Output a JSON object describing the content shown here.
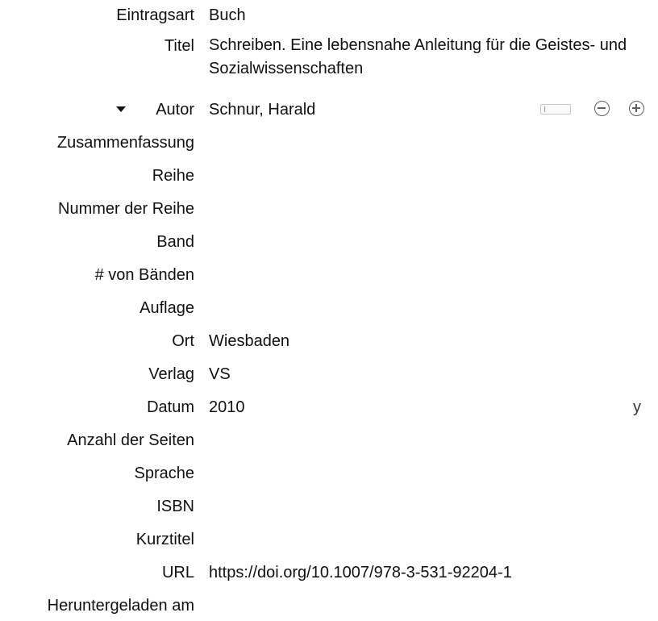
{
  "fields": {
    "item_type": {
      "label": "Eintragsart",
      "value": "Buch"
    },
    "title": {
      "label": "Titel",
      "value": "Schreiben. Eine lebensnahe Anleitung für die Geistes- und Sozialwissenschaften"
    },
    "author": {
      "label": "Autor",
      "value": "Schnur, Harald"
    },
    "abstract": {
      "label": "Zusammenfassung",
      "value": ""
    },
    "series": {
      "label": "Reihe",
      "value": ""
    },
    "series_number": {
      "label": "Nummer der Reihe",
      "value": ""
    },
    "volume": {
      "label": "Band",
      "value": ""
    },
    "num_volumes": {
      "label": "# von Bänden",
      "value": ""
    },
    "edition": {
      "label": "Auflage",
      "value": ""
    },
    "place": {
      "label": "Ort",
      "value": "Wiesbaden"
    },
    "publisher": {
      "label": "Verlag",
      "value": "VS"
    },
    "date": {
      "label": "Datum",
      "value": "2010",
      "order_indicator": "y"
    },
    "num_pages": {
      "label": "Anzahl der Seiten",
      "value": ""
    },
    "language": {
      "label": "Sprache",
      "value": ""
    },
    "isbn": {
      "label": "ISBN",
      "value": ""
    },
    "short_title": {
      "label": "Kurztitel",
      "value": ""
    },
    "url": {
      "label": "URL",
      "value": "https://doi.org/10.1007/978-3-531-92204-1"
    },
    "access_date": {
      "label": "Heruntergeladen am",
      "value": ""
    }
  },
  "icons": {
    "twisty": "triangle-down-icon",
    "creator_switch": "field-mode-switch-icon",
    "remove_creator": "minus-circle-icon",
    "add_creator": "plus-circle-icon"
  }
}
